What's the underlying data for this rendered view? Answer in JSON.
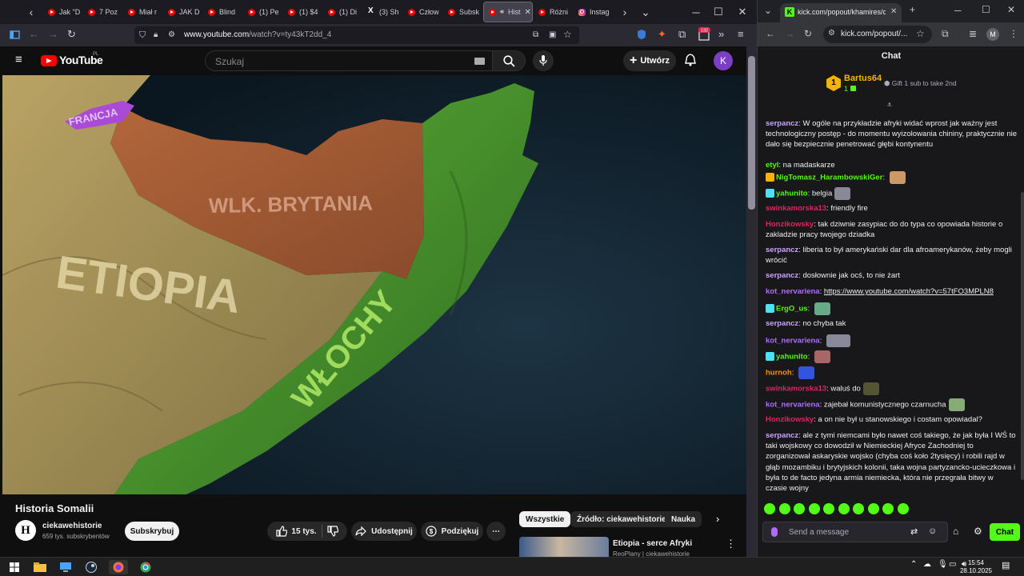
{
  "firefox": {
    "tabs": [
      {
        "label": "Jak \"D",
        "icon": "youtube-icon"
      },
      {
        "label": "7 Poz",
        "icon": "youtube-icon"
      },
      {
        "label": "Miał r",
        "icon": "youtube-icon"
      },
      {
        "label": "JAK D",
        "icon": "youtube-icon"
      },
      {
        "label": "Blind",
        "icon": "youtube-icon"
      },
      {
        "label": "(1) Pe",
        "icon": "youtube-icon"
      },
      {
        "label": "(1) $4",
        "icon": "youtube-icon"
      },
      {
        "label": "(1) Di",
        "icon": "youtube-icon"
      },
      {
        "label": "(3) Sh",
        "icon": "x-icon"
      },
      {
        "label": "Człow",
        "icon": "youtube-icon"
      },
      {
        "label": "Subsk",
        "icon": "youtube-icon"
      },
      {
        "label": "Hist",
        "icon": "youtube-icon",
        "active": true
      },
      {
        "label": "Różni",
        "icon": "youtube-icon"
      },
      {
        "label": "Instag",
        "icon": "instagram-icon"
      }
    ],
    "url_host": "www.youtube.com",
    "url_path": "/watch?v=ty43kT2dd_4",
    "notif_count": "132"
  },
  "youtube": {
    "logo": "YouTube",
    "region": "PL",
    "search_placeholder": "Szukaj",
    "create_label": "Utwórz",
    "avatar_letter": "K",
    "map_labels": {
      "france": "FRANCJA",
      "britain": "WLK. BRYTANIA",
      "ethiopia": "ETIOPIA",
      "italy": "WŁOCHY"
    },
    "video_title": "Historia Somalii",
    "channel_initial": "H",
    "channel_name": "ciekawehistorie",
    "channel_subs": "659 tys. subskrybentów",
    "subscribe_label": "Subskrybuj",
    "likes": "15 tys.",
    "share_label": "Udostępnij",
    "thanks_label": "Podziękuj",
    "chips": [
      "Wszystkie",
      "Źródło: ciekawehistorie",
      "Nauka"
    ],
    "rec_title": "Etiopia - serce Afryki",
    "rec_channel": "ReoPlany | ciekawehistorie"
  },
  "chrome": {
    "tab_title": "kick.com/popout/khamires/chat",
    "url": "kick.com/popout/...",
    "profile_letter": "M"
  },
  "chat": {
    "header": "Chat",
    "pinned": {
      "rank": "1",
      "name": "Bartus64",
      "count": "1",
      "gift_text": "Gift 1 sub to take 2nd"
    },
    "messages": [
      {
        "user": "serpancz",
        "color": "#c9a3ff",
        "text": "W ogóle na przykładzie afryki widać wprost jak ważny jest technologiczny postęp - do momentu wyizolowania chininy, praktycznie nie dało się bezpiecznie penetrować głębi kontynentu"
      },
      {
        "user": "etyl",
        "color": "#53fc18",
        "text": "na madaskarze"
      },
      {
        "user": "NigTomasz_HarambowskiGer",
        "color": "#53fc18",
        "text": ""
      },
      {
        "user": "yahunito",
        "color": "#53fc18",
        "text": "belgia"
      },
      {
        "user": "swinkamorska13",
        "color": "#e0245e",
        "text": "friendly fire"
      },
      {
        "user": "Honzikowsky",
        "color": "#e0245e",
        "text": "tak dziwnie zasypiac do do typa co opowiada historie o zakladzie pracy twojego dziadka"
      },
      {
        "user": "serpancz",
        "color": "#c9a3ff",
        "text": "liberia to był amerykański dar dla afroamerykanów, żeby mogli wrócić"
      },
      {
        "user": "serpancz",
        "color": "#c9a3ff",
        "text": "dosłownie jak ocś, to nie żart"
      },
      {
        "user": "kot_nervariena",
        "color": "#b06cff",
        "link": "https://www.youtube.com/watch?v=57tFO3MPLN8"
      },
      {
        "user": "ErgO_us",
        "color": "#53fc18",
        "text": ""
      },
      {
        "user": "serpancz",
        "color": "#c9a3ff",
        "text": "no chyba tak"
      },
      {
        "user": "kot_nervariena",
        "color": "#b06cff",
        "text": ""
      },
      {
        "user": "yahunito",
        "color": "#53fc18",
        "text": ""
      },
      {
        "user": "hurnoh",
        "color": "#ff8c1a",
        "text": ""
      },
      {
        "user": "swinkamorska13",
        "color": "#e0245e",
        "text": "waluś do"
      },
      {
        "user": "kot_nervariena",
        "color": "#b06cff",
        "text": "zajebał komunistycznego czarnucha"
      },
      {
        "user": "Honzikowsky",
        "color": "#e0245e",
        "text": "a on nie był u stanowskiego i costam opowiadal?"
      },
      {
        "user": "serpancz",
        "color": "#c9a3ff",
        "text": "ale z tymi niemcami było nawet coś takiego, że jak była I WŚ to taki wojskowy co dowodził w Niemieckiej Afryce Zachodniej to zorganizował askaryskie wojsko (chyba coś koło 2tysięcy) i robili rajd w głąb mozambiku i brytyjskich kolonii, taka wojna partyzancko-ucieczkowa i była to de facto jedyna armia niemiecka, która nie przegrała bitwy w czasie wojny"
      }
    ],
    "input_placeholder": "Send a message",
    "send_label": "Chat"
  },
  "taskbar": {
    "time": "15:54",
    "date": "28.10.2025"
  }
}
